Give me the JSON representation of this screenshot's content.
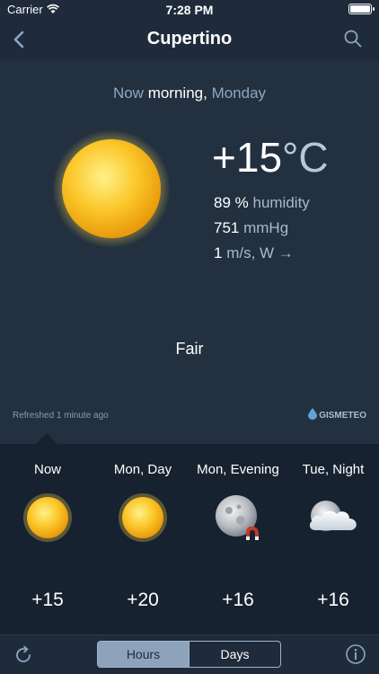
{
  "status_bar": {
    "carrier": "Carrier",
    "time": "7:28 PM"
  },
  "nav": {
    "title": "Cupertino"
  },
  "current": {
    "period_now": "Now",
    "period_time": "morning,",
    "period_day": "Monday",
    "temperature": "+15",
    "temperature_unit": "°C",
    "humidity_value": "89 %",
    "humidity_label": "humidity",
    "pressure_value": "751",
    "pressure_unit": "mmHg",
    "wind_value": "1",
    "wind_unit": "m/s, W →",
    "condition": "Fair",
    "refreshed": "Refreshed 1 minute ago",
    "brand": "GISMETEO"
  },
  "forecast": [
    {
      "label": "Now",
      "temp": "+15",
      "icon": "sun-icon"
    },
    {
      "label": "Mon, Day",
      "temp": "+20",
      "icon": "sun-icon"
    },
    {
      "label": "Mon, Evening",
      "temp": "+16",
      "icon": "moon-icon"
    },
    {
      "label": "Tue, Night",
      "temp": "+16",
      "icon": "moon-cloud-icon"
    }
  ],
  "toolbar": {
    "hours_label": "Hours",
    "days_label": "Days",
    "active": "Hours"
  },
  "colors": {
    "background": "#1f2b3b",
    "panel": "#22303f",
    "forecast": "#172230",
    "accent": "#8da3bc",
    "sun": "#f6c21c"
  }
}
